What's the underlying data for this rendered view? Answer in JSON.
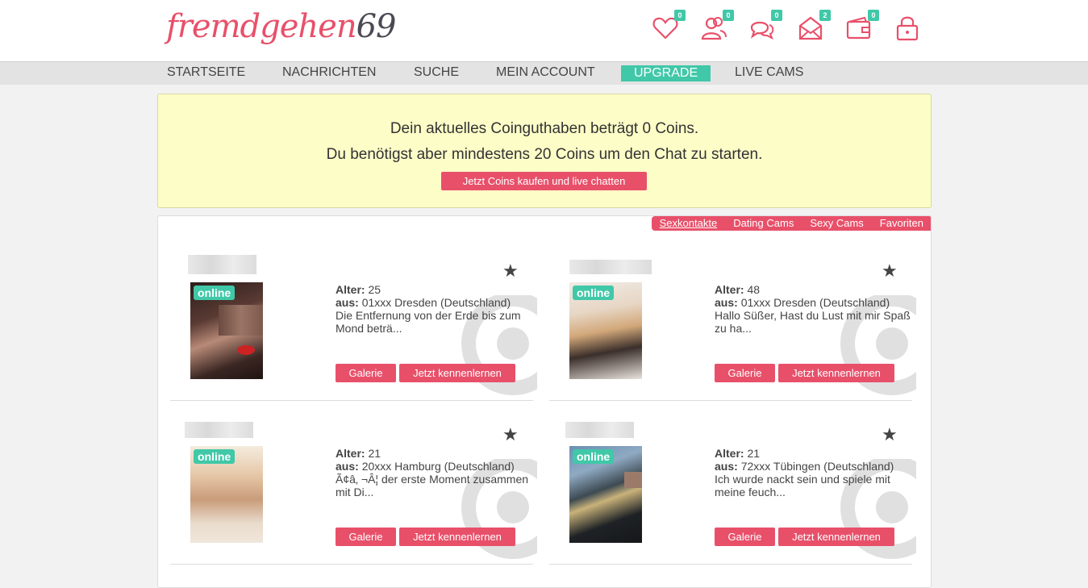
{
  "logo": {
    "text_main": "fremdgehen",
    "text_num": "69"
  },
  "header_icons": [
    {
      "name": "heart-icon",
      "badge": "0"
    },
    {
      "name": "users-icon",
      "badge": "0"
    },
    {
      "name": "chat-icon",
      "badge": "0"
    },
    {
      "name": "mail-icon",
      "badge": "2"
    },
    {
      "name": "wallet-icon",
      "badge": "0"
    },
    {
      "name": "lock-icon",
      "badge": ""
    }
  ],
  "nav": {
    "startseite": "STARTSEITE",
    "nachrichten": "NACHRICHTEN",
    "suche": "SUCHE",
    "mein_account": "MEIN ACCOUNT",
    "upgrade": "UPGRADE",
    "live_cams": "LIVE CAMS"
  },
  "notice": {
    "line1": "Dein aktuelles Coinguthaben beträgt 0 Coins.",
    "line2": "Du benötigst aber mindestens 20 Coins um den Chat zu starten.",
    "button": "Jetzt Coins kaufen und live chatten"
  },
  "tabs": [
    "Sexkontakte",
    "Dating Cams",
    "Sexy Cams",
    "Favoriten"
  ],
  "labels": {
    "alter": "Alter:",
    "aus": "aus:",
    "online": "online",
    "galerie": "Galerie",
    "kennenlernen": "Jetzt kennenlernen"
  },
  "profiles": [
    {
      "alter": "25",
      "aus": "01xxx Dresden (Deutschland)",
      "text": "Die Entfernung von der Erde bis zum Mond beträ..."
    },
    {
      "alter": "48",
      "aus": "01xxx Dresden (Deutschland)",
      "text": "Hallo Süßer, Hast du Lust mit mir Spaß zu ha..."
    },
    {
      "alter": "21",
      "aus": "20xxx Hamburg (Deutschland)",
      "text": "Ã¢â‚ ¬Â¦ der erste Moment zusammen mit Di..."
    },
    {
      "alter": "21",
      "aus": "72xxx Tübingen (Deutschland)",
      "text": "Ich wurde nackt sein und spiele mit meine feuch..."
    }
  ],
  "colors": {
    "accent": "#e8506a",
    "teal": "#40c8a8",
    "notice_bg": "#fdfdc8"
  }
}
